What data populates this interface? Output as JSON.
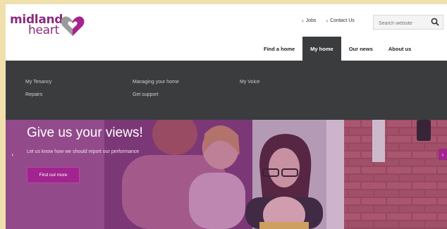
{
  "brand": {
    "line1": "midland",
    "line2": "heart",
    "color": "#8a2b7e"
  },
  "utility_links": [
    {
      "label": "Jobs",
      "icon": "chevron-right-icon"
    },
    {
      "label": "Contact Us",
      "icon": "chevron-right-icon"
    }
  ],
  "search": {
    "placeholder": "Search website",
    "icon": "search-icon"
  },
  "main_nav": [
    {
      "label": "Find a home",
      "active": false
    },
    {
      "label": "My home",
      "active": true
    },
    {
      "label": "Our news",
      "active": false
    },
    {
      "label": "About us",
      "active": false
    }
  ],
  "dropdown": {
    "items": [
      {
        "label": "My Tenancy"
      },
      {
        "label": "Repairs"
      },
      {
        "label": "Managing your home"
      },
      {
        "label": "Get support"
      },
      {
        "label": "My Voice"
      }
    ]
  },
  "hero": {
    "title": "Give us your views!",
    "subtitle": "Let us know how we should report our performance",
    "button_label": "Find out more",
    "prev_icon": "chevron-left-icon",
    "next_icon": "chevron-right-icon"
  },
  "colors": {
    "accent": "#a3238f",
    "nav_dark": "#3a3c3e",
    "page_bg": "#efe0ad"
  }
}
